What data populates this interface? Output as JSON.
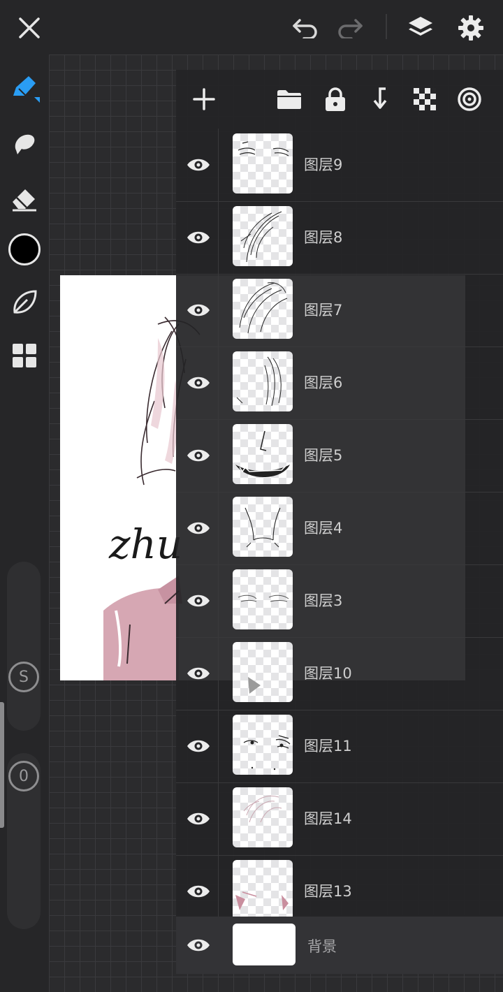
{
  "topbar": {
    "icons": [
      "close-icon",
      "undo-icon",
      "redo-icon",
      "layers-icon",
      "settings-icon"
    ]
  },
  "left_toolbar": {
    "tools": [
      "brush-icon",
      "smudge-icon",
      "eraser-icon",
      "color-swatch",
      "leaf-icon",
      "gallery-icon"
    ],
    "current_color": "#000000",
    "accent_color": "#2a9df4",
    "size_slider_label": "S",
    "opacity_slider_label": "0"
  },
  "layers_panel": {
    "toolbar_icons": [
      "add-layer-icon",
      "folder-icon",
      "lock-icon",
      "merge-down-icon",
      "transparency-icon",
      "blend-icon"
    ],
    "layers": [
      {
        "name": "图层9"
      },
      {
        "name": "图层8"
      },
      {
        "name": "图层7"
      },
      {
        "name": "图层6"
      },
      {
        "name": "图层5"
      },
      {
        "name": "图层4"
      },
      {
        "name": "图层3"
      },
      {
        "name": "图层10"
      },
      {
        "name": "图层11"
      },
      {
        "name": "图层14"
      },
      {
        "name": "图层13"
      }
    ],
    "background_layer": {
      "name": "背景"
    }
  },
  "artboard": {
    "handwriting": "zhu"
  }
}
